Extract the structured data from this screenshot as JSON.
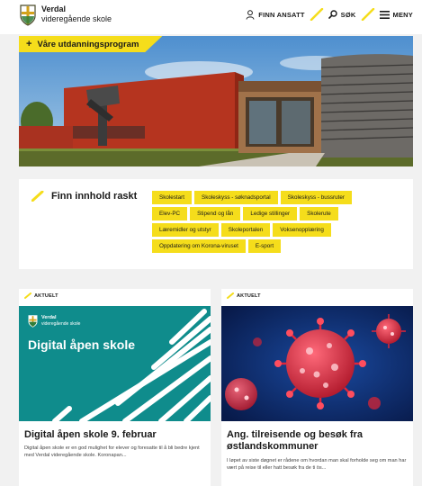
{
  "header": {
    "logo_name": "Verdal",
    "logo_sub": "videregående skole",
    "nav": {
      "staff": "FINN ANSATT",
      "search": "SØK",
      "menu": "MENY"
    }
  },
  "hero": {
    "tab_plus": "+",
    "tab_label": "Våre utdanningsprogram"
  },
  "quick": {
    "title": "Finn innhold raskt",
    "links": [
      "Skolestart",
      "Skoleskyss - søknadsportal",
      "Skoleskyss - bussruter",
      "Elev-PC",
      "Stipend og lån",
      "Ledige stillinger",
      "Skolerute",
      "Læremidler og utstyr",
      "Skoleportalen",
      "Voksenopplæring",
      "Oppdatering om Korona-viruset",
      "E-sport"
    ]
  },
  "cards": [
    {
      "tag": "AKTUELT",
      "image_brand_name": "Verdal",
      "image_brand_sub": "videregående skole",
      "image_big": "Digital åpen skole",
      "title": "Digital åpen skole 9. februar",
      "desc": "Digital åpen skole er en god mulighet for elever og foresatte til å bli bedre kjent med Verdal videregående skole. Koronapan..."
    },
    {
      "tag": "AKTUELT",
      "title": "Ang. tilreisende og besøk fra østlandskommuner",
      "desc": "I løpet av siste døgnet er rådene om hvordan man skal forholde seg om man har vært på reise til eller hatt besøk fra de ti ös..."
    }
  ],
  "colors": {
    "accent_yellow": "#f5dd1b",
    "teal": "#0f8c8c",
    "virus_blue": "#0c2a6b",
    "virus_red": "#e0263b"
  },
  "icons": {
    "staff": "person-icon",
    "search": "search-icon",
    "menu": "hamburger-menu-icon",
    "logo": "shield-cross-icon"
  }
}
